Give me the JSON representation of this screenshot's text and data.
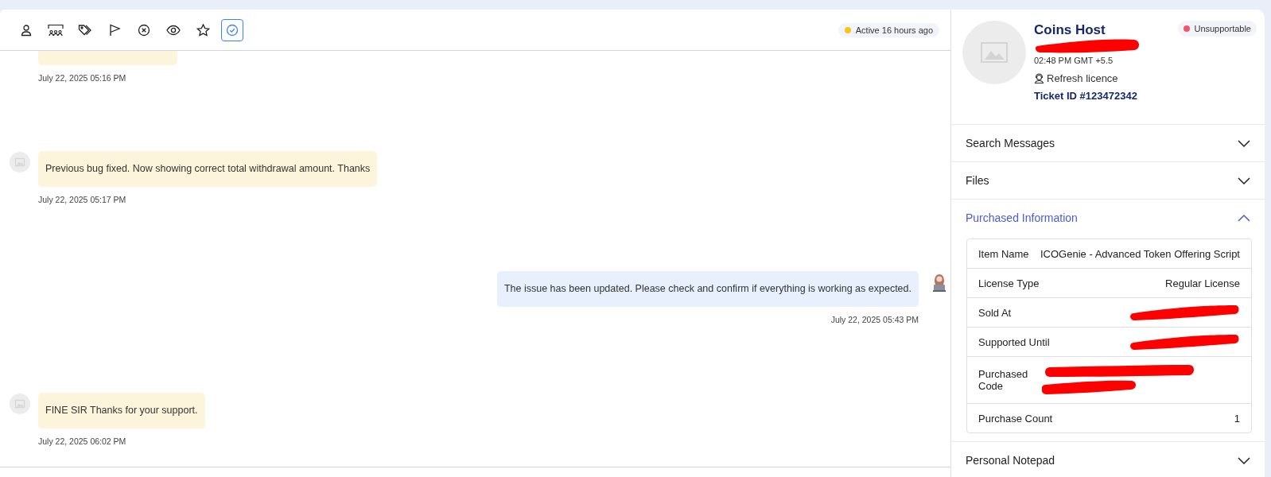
{
  "toolbar": {
    "tools": [
      {
        "kind": "user",
        "selected": false
      },
      {
        "kind": "group",
        "selected": false
      },
      {
        "kind": "tags",
        "selected": false
      },
      {
        "kind": "flag",
        "selected": false
      },
      {
        "kind": "close",
        "selected": false
      },
      {
        "kind": "eye",
        "selected": false
      },
      {
        "kind": "star",
        "selected": false
      },
      {
        "kind": "check",
        "selected": true
      }
    ],
    "status": {
      "text": "Active 16 hours ago",
      "color": "#f5c518"
    }
  },
  "messages": [
    {
      "kind": "incoming",
      "clipped": true,
      "time": "July 22, 2025 05:16 PM"
    },
    {
      "kind": "incoming",
      "text": "Previous bug fixed. Now showing correct total withdrawal amount. Thanks",
      "time": "July 22, 2025 05:17 PM"
    },
    {
      "kind": "outgoing",
      "text": "The issue has been updated. Please check and confirm if everything is working as expected.",
      "time": "July 22, 2025 05:43 PM"
    },
    {
      "kind": "incoming",
      "text": "FINE SIR Thanks for your support.",
      "time": "July 22, 2025 06:02 PM"
    }
  ],
  "profile": {
    "name": "Coins Host",
    "local_time": "02:48 PM GMT +5.5",
    "refresh_link": "Refresh licence",
    "ticket_id": "Ticket ID #123472342",
    "badge": {
      "text": "Unsupportable",
      "color": "#f0576f"
    }
  },
  "sections": [
    {
      "title": "Search Messages",
      "expanded": false
    },
    {
      "title": "Files",
      "expanded": false
    },
    {
      "title": "Purchased Information",
      "expanded": true,
      "rows": [
        {
          "label": "Item Name",
          "value": "ICOGenie - Advanced Token Offering Script",
          "kind": "text"
        },
        {
          "label": "License Type",
          "value": "Regular License",
          "kind": "text"
        },
        {
          "label": "Sold At",
          "kind": "redacted"
        },
        {
          "label": "Supported Until",
          "kind": "redacted"
        },
        {
          "label": "Purchased Code",
          "kind": "redacted-code"
        },
        {
          "label": "Purchase Count",
          "value": "1",
          "kind": "text"
        }
      ]
    },
    {
      "title": "Personal Notepad",
      "expanded": false
    }
  ]
}
